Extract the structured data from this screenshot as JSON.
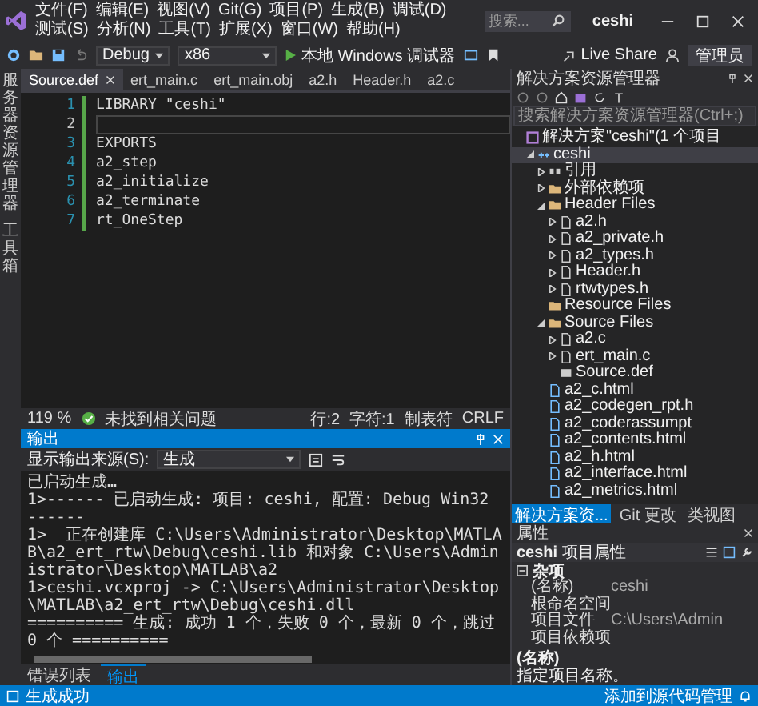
{
  "menu": {
    "items": [
      {
        "label": "文件(F)"
      },
      {
        "label": "编辑(E)"
      },
      {
        "label": "视图(V)"
      },
      {
        "label": "Git(G)"
      },
      {
        "label": "项目(P)"
      },
      {
        "label": "生成(B)"
      },
      {
        "label": "调试(D)"
      },
      {
        "label": "测试(S)"
      },
      {
        "label": "分析(N)"
      },
      {
        "label": "工具(T)"
      },
      {
        "label": "扩展(X)"
      },
      {
        "label": "窗口(W)"
      },
      {
        "label": "帮助(H)"
      }
    ]
  },
  "search": {
    "placeholder": "搜索..."
  },
  "title": "ceshi",
  "toolbar": {
    "configuration": "Debug",
    "platform": "x86",
    "run_label": "本地 Windows 调试器",
    "live_share": "Live Share",
    "admin": "管理员"
  },
  "side_strip": [
    "服务器资源管理器",
    "工具箱"
  ],
  "tabs": [
    {
      "label": "Source.def",
      "selected": true
    },
    {
      "label": "ert_main.c",
      "selected": false
    },
    {
      "label": "ert_main.obj",
      "selected": false
    },
    {
      "label": "a2.h",
      "selected": false
    },
    {
      "label": "Header.h",
      "selected": false
    },
    {
      "label": "a2.c",
      "selected": false
    }
  ],
  "editor": {
    "lines": [
      {
        "number": "1",
        "text": "LIBRARY \"ceshi\"",
        "current": false
      },
      {
        "number": "2",
        "current": true
      },
      {
        "number": "3",
        "text": "EXPORTS",
        "current": false
      },
      {
        "number": "4",
        "text": "a2_step",
        "current": false
      },
      {
        "number": "5",
        "text": "a2_initialize",
        "current": false
      },
      {
        "number": "6",
        "text": "a2_terminate",
        "current": false
      },
      {
        "number": "7",
        "text": "rt_OneStep",
        "current": false
      }
    ]
  },
  "editor_status": {
    "zoom": "119 %",
    "issues": "未找到相关问题",
    "position": [
      "行:2",
      "字符:1",
      "制表符",
      "CRLF"
    ]
  },
  "output": {
    "title": "输出",
    "source_label": "显示输出来源(S):",
    "source": "生成",
    "lines": [
      "已启动生成…",
      "1>------ 已启动生成: 项目: ceshi, 配置: Debug Win32 ------",
      "1>  正在创建库 C:\\Users\\Administrator\\Desktop\\MATLAB\\a2_ert_rtw\\Debug\\ceshi.lib 和对象 C:\\Users\\Administrator\\Desktop\\MATLAB\\a2",
      "1>ceshi.vcxproj -> C:\\Users\\Administrator\\Desktop\\MATLAB\\a2_ert_rtw\\Debug\\ceshi.dll",
      "========== 生成: 成功 1 个，失败 0 个，最新 0 个，跳过 0 个 =========="
    ]
  },
  "bottom_tabs": [
    {
      "label": "错误列表",
      "selected": false
    },
    {
      "label": "输出",
      "selected": true
    }
  ],
  "solution_explorer": {
    "title": "解决方案资源管理器",
    "search": {
      "placeholder": "搜索解决方案资源管理器(Ctrl+;)"
    },
    "tree": [
      {
        "label": "解决方案\"ceshi\"(1 个项目",
        "kind": "solution",
        "selected": false,
        "children": [
          {
            "label": "ceshi",
            "kind": "project",
            "expanded": true,
            "selected": true,
            "children": [
              {
                "label": "引用",
                "kind": "references",
                "expanded": false,
                "selected": false
              },
              {
                "label": "外部依赖项",
                "kind": "folder",
                "expanded": false,
                "selected": false
              },
              {
                "label": "Header Files",
                "kind": "folder",
                "expanded": true,
                "selected": false,
                "children": [
                  {
                    "label": "a2.h",
                    "kind": "file",
                    "expanded": false,
                    "selected": false
                  },
                  {
                    "label": "a2_private.h",
                    "kind": "file",
                    "expanded": false,
                    "selected": false
                  },
                  {
                    "label": "a2_types.h",
                    "kind": "file",
                    "expanded": false,
                    "selected": false
                  },
                  {
                    "label": "Header.h",
                    "kind": "file",
                    "expanded": false,
                    "selected": false
                  },
                  {
                    "label": "rtwtypes.h",
                    "kind": "file",
                    "expanded": false,
                    "selected": false
                  }
                ]
              },
              {
                "label": "Resource Files",
                "kind": "folder",
                "selected": false
              },
              {
                "label": "Source Files",
                "kind": "folder",
                "expanded": true,
                "selected": false,
                "children": [
                  {
                    "label": "a2.c",
                    "kind": "file",
                    "expanded": false,
                    "selected": false
                  },
                  {
                    "label": "ert_main.c",
                    "kind": "file",
                    "expanded": false,
                    "selected": false
                  },
                  {
                    "label": "Source.def",
                    "kind": "def",
                    "selected": false
                  }
                ]
              },
              {
                "label": "a2_c.html",
                "kind": "page",
                "selected": false
              },
              {
                "label": "a2_codegen_rpt.h",
                "kind": "page",
                "selected": false
              },
              {
                "label": "a2_coderassumpt",
                "kind": "page",
                "selected": false
              },
              {
                "label": "a2_contents.html",
                "kind": "page",
                "selected": false
              },
              {
                "label": "a2_h.html",
                "kind": "page",
                "selected": false
              },
              {
                "label": "a2_interface.html",
                "kind": "page",
                "selected": false
              },
              {
                "label": "a2_metrics.html",
                "kind": "page",
                "selected": false
              }
            ]
          }
        ]
      }
    ],
    "tabs": [
      {
        "label": "解决方案资...",
        "selected": true
      },
      {
        "label": "Git 更改",
        "selected": false
      },
      {
        "label": "类视图",
        "selected": false
      }
    ]
  },
  "properties": {
    "title": "属性",
    "object": "ceshi",
    "object_type": "项目属性",
    "category": "杂项",
    "rows": [
      {
        "name": "(名称)",
        "value": "ceshi"
      },
      {
        "name": "根命名空间"
      },
      {
        "name": "项目文件",
        "value": "C:\\Users\\Admin"
      },
      {
        "name": "项目依赖项"
      }
    ],
    "description_title": "(名称)",
    "description": "指定项目名称。"
  },
  "status_bar": {
    "text": "生成成功",
    "action": "添加到源代码管理"
  }
}
